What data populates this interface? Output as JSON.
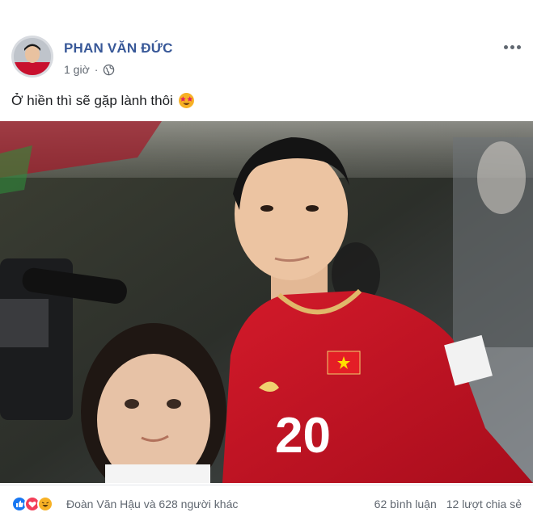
{
  "post": {
    "author": "PHAN VĂN ĐỨC",
    "time": "1 giờ",
    "privacy_icon": "globe-icon",
    "caption": "Ở hiền thì sẽ gặp lành thôi",
    "caption_emoji": "star-struck-emoji-icon",
    "more_icon": "more-options-icon"
  },
  "photo": {
    "jersey_number": "20"
  },
  "footer": {
    "reaction_icons": [
      "like-reaction-icon",
      "love-reaction-icon",
      "haha-reaction-icon"
    ],
    "likes_text": "Đoàn Văn Hậu và 628 người khác",
    "comments": "62 bình luận",
    "shares": "12 lượt chia sẻ"
  },
  "colors": {
    "author_blue": "#385898",
    "jersey_red": "#c8102e",
    "like_blue": "#1877f2",
    "love_red": "#f33e58",
    "haha_yellow": "#f7b125"
  }
}
